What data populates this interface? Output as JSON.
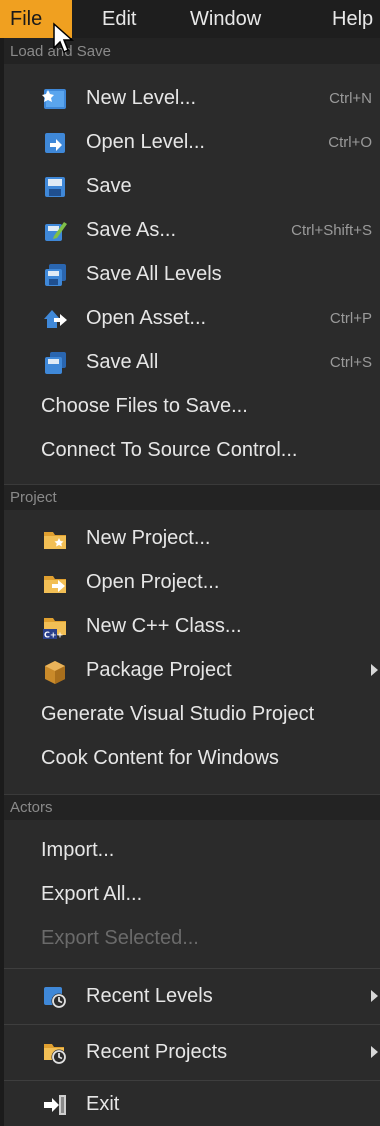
{
  "menubar": {
    "items": [
      "File",
      "Edit",
      "Window",
      "Help"
    ],
    "active_color": "#f0a020"
  },
  "sections": {
    "load_save": "Load and Save",
    "project": "Project",
    "actors": "Actors"
  },
  "load_save_items": [
    {
      "label": "New Level...",
      "shortcut": "Ctrl+N",
      "icon": "new-level-icon"
    },
    {
      "label": "Open Level...",
      "shortcut": "Ctrl+O",
      "icon": "open-level-icon"
    },
    {
      "label": "Save",
      "shortcut": "",
      "icon": "save-icon"
    },
    {
      "label": "Save As...",
      "shortcut": "Ctrl+Shift+S",
      "icon": "save-as-icon"
    },
    {
      "label": "Save All Levels",
      "shortcut": "",
      "icon": "save-all-levels-icon"
    },
    {
      "label": "Open Asset...",
      "shortcut": "Ctrl+P",
      "icon": "open-asset-icon"
    },
    {
      "label": "Save All",
      "shortcut": "Ctrl+S",
      "icon": "save-all-icon"
    },
    {
      "label": "Choose Files to Save...",
      "shortcut": ""
    },
    {
      "label": "Connect To Source Control...",
      "shortcut": ""
    }
  ],
  "project_items": [
    {
      "label": "New Project...",
      "icon": "new-project-icon"
    },
    {
      "label": "Open Project...",
      "icon": "open-project-icon"
    },
    {
      "label": "New C++ Class...",
      "icon": "cpp-class-icon"
    },
    {
      "label": "Package Project",
      "icon": "package-icon"
    },
    {
      "label": "Generate Visual Studio Project"
    },
    {
      "label": "Cook Content for Windows"
    }
  ],
  "actors_items": [
    {
      "label": "Import..."
    },
    {
      "label": "Export All..."
    },
    {
      "label": "Export Selected..."
    }
  ],
  "recent": {
    "levels": "Recent Levels",
    "projects": "Recent Projects"
  },
  "exit": "Exit"
}
